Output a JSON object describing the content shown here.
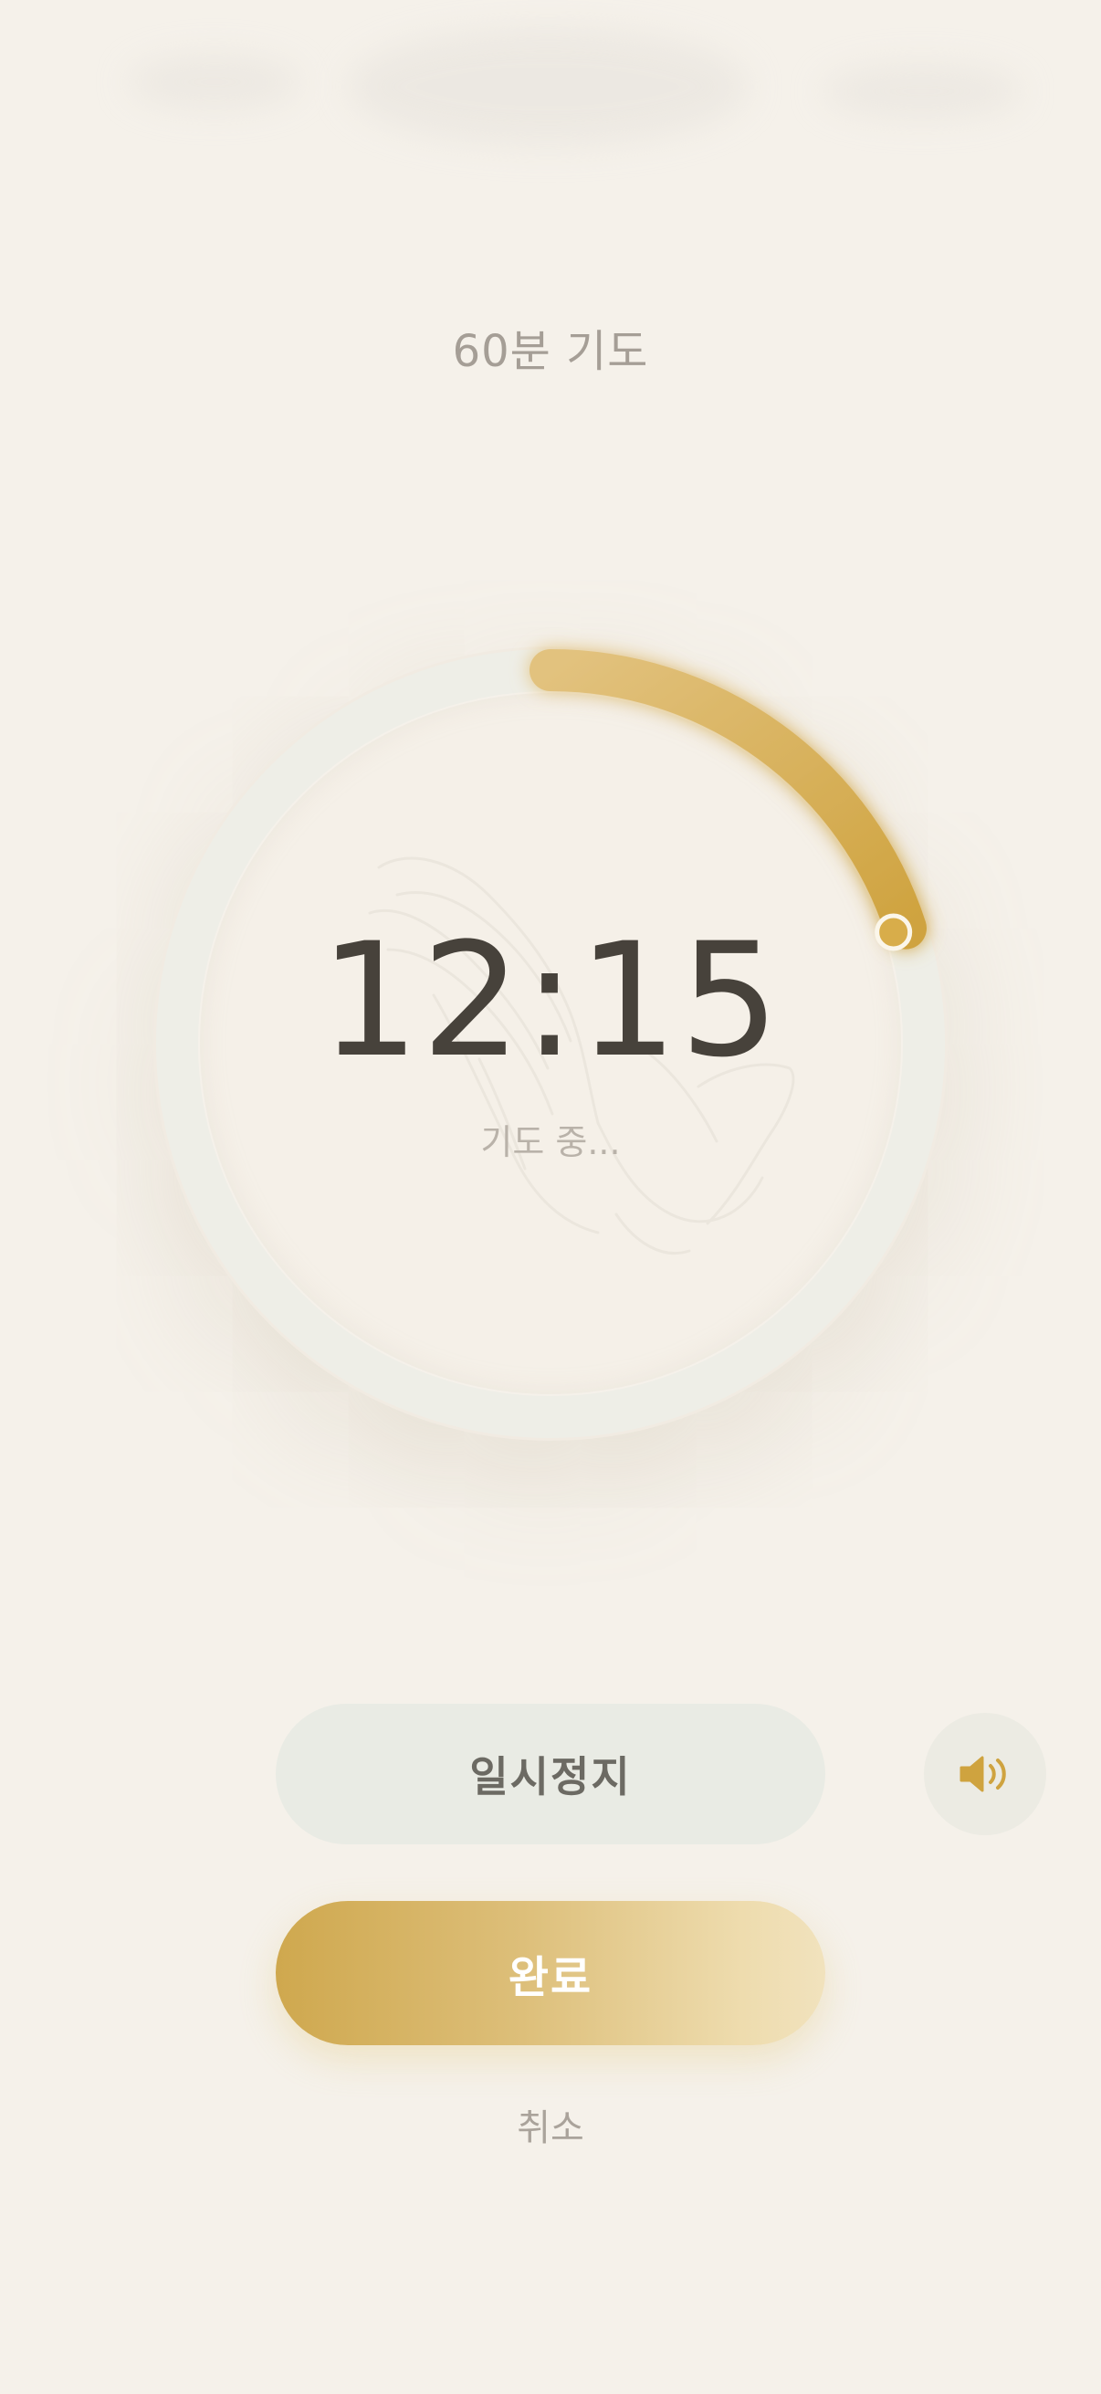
{
  "header": {
    "session_title": "60분 기도"
  },
  "timer": {
    "remaining_time": "12:15",
    "status": "기도 중...",
    "progress_fraction": 0.2,
    "track_color": "#eeeee7",
    "progress_color_start": "#e2c27e",
    "progress_color_end": "#cfa33f"
  },
  "controls": {
    "pause_label": "일시정지",
    "done_label": "완료",
    "cancel_label": "취소",
    "sound_icon": "speaker-volume-icon"
  },
  "colors": {
    "background": "#f5f1ea",
    "accent_gold": "#cfa33f",
    "pause_bg": "#e9ebe4",
    "text_dark": "#47423b"
  }
}
